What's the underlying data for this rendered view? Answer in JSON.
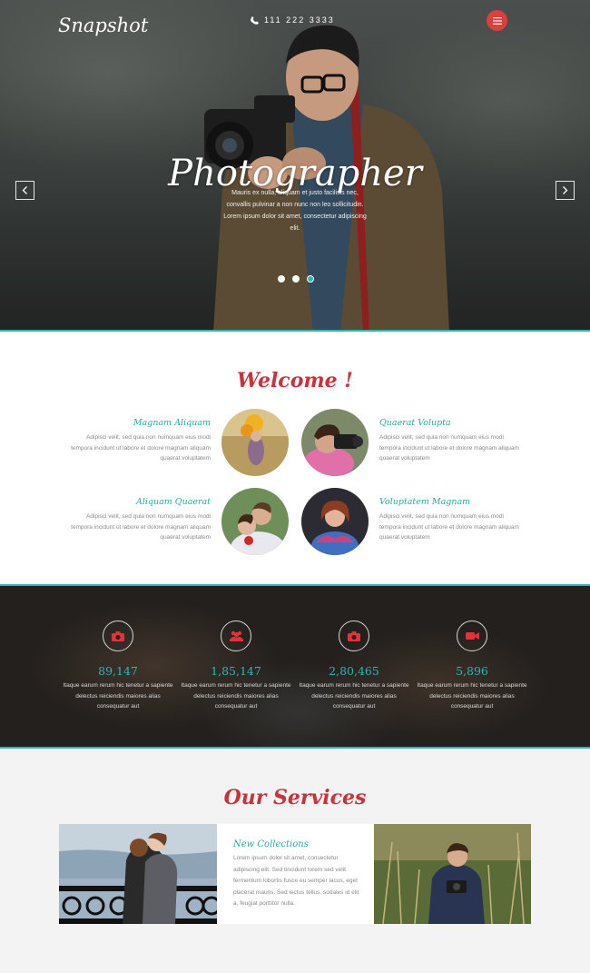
{
  "header": {
    "logo": "Snapshot",
    "phone": "111 222 3333"
  },
  "hero": {
    "title": "Photographer",
    "text": "Mauris ex nulla, aliquam et justo facilisis nec, convallis pulvinar a non nunc non leo sollicitudin. Lorem ipsum dolor sit amet, consectetur adipiscing elit.",
    "slides": 3,
    "active_slide": 3
  },
  "welcome": {
    "title": "Welcome !",
    "features": [
      {
        "title": "Magnam Aliquam",
        "text": "Adipisci velit, sed quia non numquam eius modi tempora incidunt ut labore et dolore magnam aliquam quaerat voluptatem"
      },
      {
        "title": "Quaerat Volupta",
        "text": "Adipisci velit, sed quia non numquam eius modi tempora incidunt ut labore et dolore magnam aliquam quaerat voluptatem"
      },
      {
        "title": "Aliquam Quaerat",
        "text": "Adipisci velit, sed quia non numquam eius modi tempora incidunt ut labore et dolore magnam aliquam quaerat voluptatem"
      },
      {
        "title": "Voluptatem Magnam",
        "text": "Adipisci velit, sed quia non numquam eius modi tempora incidunt ut labore et dolore magnam aliquam quaerat voluptatem"
      }
    ]
  },
  "stats": [
    {
      "icon": "camera-icon",
      "value": "89,147",
      "text": "Itaque earum rerum hic tenetur a sapiente delectus reiciendis maiores alias consequatur aut"
    },
    {
      "icon": "users-icon",
      "value": "1,85,147",
      "text": "Itaque earum rerum hic tenetur a sapiente delectus reiciendis maiores alias consequatur aut"
    },
    {
      "icon": "camera-icon",
      "value": "2,80,465",
      "text": "Itaque earum rerum hic tenetur a sapiente delectus reiciendis maiores alias consequatur aut"
    },
    {
      "icon": "video-camera-icon",
      "value": "5,896",
      "text": "Itaque earum rerum hic tenetur a sapiente delectus reiciendis maiores alias consequatur aut"
    }
  ],
  "services": {
    "title": "Our Services",
    "card_title": "New Collections",
    "card_text": "Lorem ipsum dolor sit amet, consectetur adipiscing elit. Sed tincidunt lorem sed velit fermentum lobortis fusce eu semper lacus, eget placerat mauris. Sed lectus tellus, sodales id elit a, feugiat porttitor nulla."
  },
  "colors": {
    "accent": "#2fb5b5",
    "brand_red": "#c8333a",
    "menu_button": "#d9413f"
  }
}
